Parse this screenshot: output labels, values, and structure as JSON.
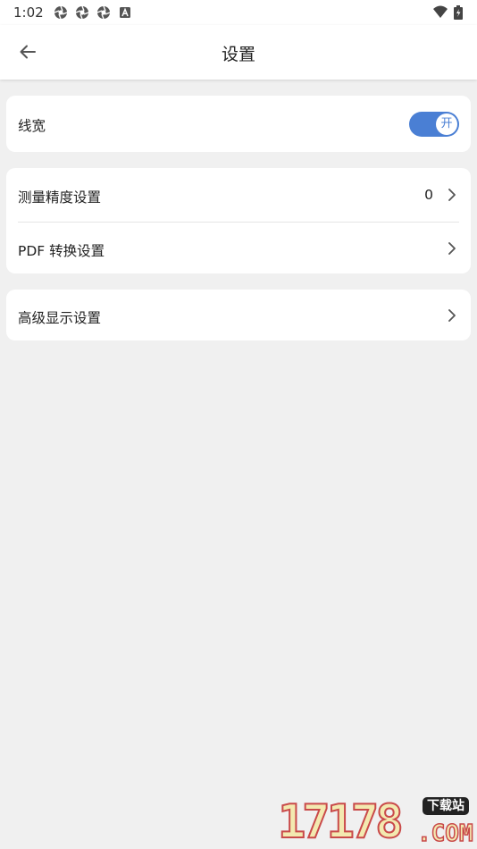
{
  "status_bar": {
    "time": "1:02",
    "left_icons": [
      "aperture-icon",
      "aperture-icon",
      "aperture-icon",
      "a-badge-icon"
    ],
    "right_icons": [
      "wifi-icon",
      "battery-icon"
    ]
  },
  "app_bar": {
    "title": "设置",
    "back_icon": "arrow-left-icon"
  },
  "cards": {
    "line_width": {
      "label": "线宽",
      "toggle_on": true,
      "toggle_text": "开",
      "accent": "#4a7fd4"
    },
    "measurement": {
      "precision_label": "测量精度设置",
      "precision_value": "0",
      "pdf_label": "PDF 转换设置"
    },
    "advanced": {
      "label": "高级显示设置"
    }
  },
  "watermark": {
    "digits": "17178",
    "tag": "下载站",
    "suffix": ".COM"
  }
}
